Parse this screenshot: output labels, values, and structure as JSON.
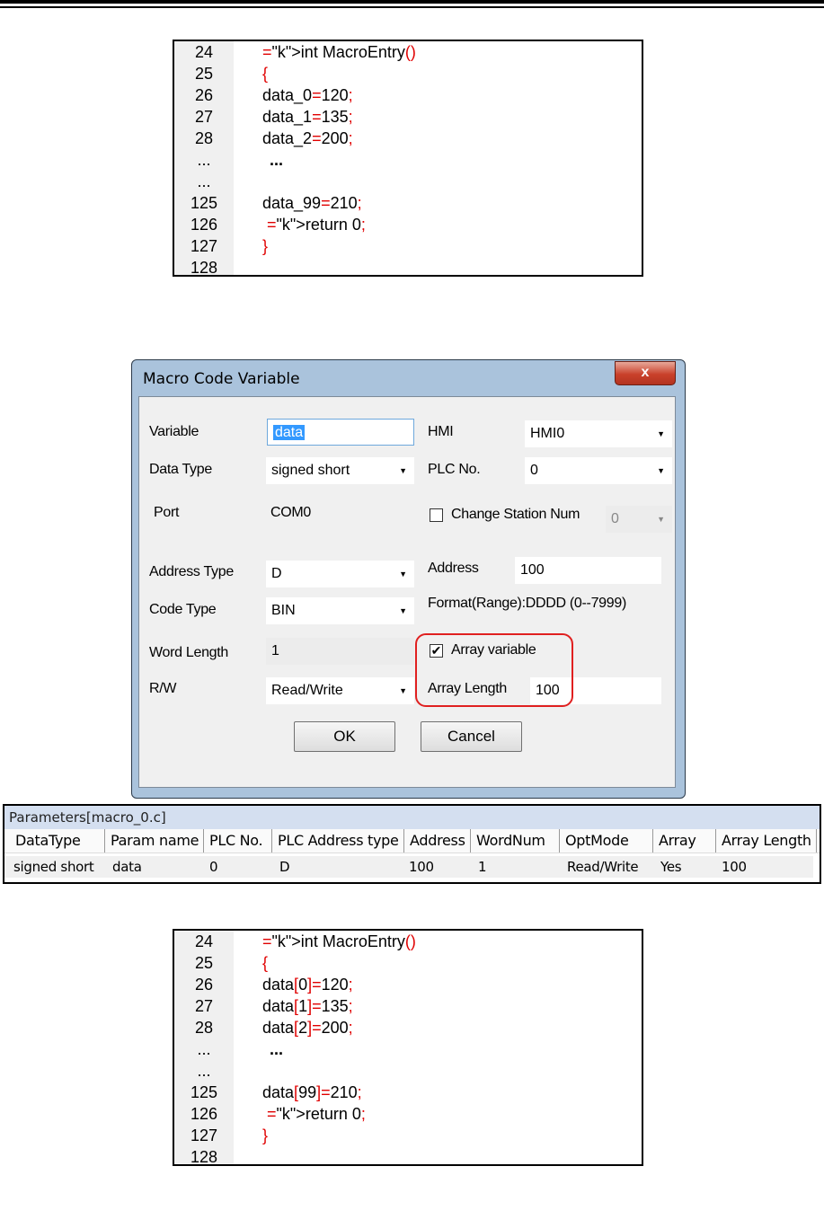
{
  "code_block_1": {
    "lines": [
      {
        "num": "24",
        "text": "int MacroEntry()"
      },
      {
        "num": "25",
        "text": "{"
      },
      {
        "num": "26",
        "text": "data_0=120;"
      },
      {
        "num": "27",
        "text": "data_1=135;"
      },
      {
        "num": "28",
        "text": "data_2=200;"
      },
      {
        "num": "...",
        "text": "..."
      },
      {
        "num": "...",
        "text": ""
      },
      {
        "num": "125",
        "text": "data_99=210;"
      },
      {
        "num": "126",
        "text": " return 0;"
      },
      {
        "num": "127",
        "text": "}"
      },
      {
        "num": "128",
        "text": ""
      }
    ]
  },
  "dialog": {
    "title": "Macro Code Variable",
    "close_glyph": "x",
    "variable_label": "Variable",
    "variable_value": "data",
    "hmi_label": "HMI",
    "hmi_value": "HMI0",
    "data_type_label": "Data Type",
    "data_type_value": "signed short",
    "plc_no_label": "PLC No.",
    "plc_no_value": "0",
    "port_label": "Port",
    "port_value": "COM0",
    "change_station_label": "Change Station Num",
    "change_station_value": "0",
    "address_type_label": "Address Type",
    "address_type_value": "D",
    "address_label": "Address",
    "address_value": "100",
    "code_type_label": "Code Type",
    "code_type_value": "BIN",
    "format_text": "Format(Range):DDDD (0--7999)",
    "word_length_label": "Word Length",
    "word_length_value": "1",
    "array_variable_label": "Array variable",
    "array_variable_checked": true,
    "rw_label": "R/W",
    "rw_value": "Read/Write",
    "array_length_label": "Array Length",
    "array_length_value": "100",
    "ok_label": "OK",
    "cancel_label": "Cancel"
  },
  "parameters": {
    "title": "Parameters[macro_0.c]",
    "headers": [
      "DataType",
      "Param name",
      "PLC No.",
      "PLC Address type",
      "Address",
      "WordNum",
      "OptMode",
      "Array",
      "Array Length"
    ],
    "row": [
      "signed short",
      "data",
      "0",
      "D",
      "100",
      "1",
      "Read/Write",
      "Yes",
      "100"
    ]
  },
  "code_block_2": {
    "lines": [
      {
        "num": "24",
        "text": "int MacroEntry()"
      },
      {
        "num": "25",
        "text": "{"
      },
      {
        "num": "26",
        "text": "data[0]=120;"
      },
      {
        "num": "27",
        "text": "data[1]=135;"
      },
      {
        "num": "28",
        "text": "data[2]=200;"
      },
      {
        "num": "...",
        "text": "..."
      },
      {
        "num": "...",
        "text": ""
      },
      {
        "num": "125",
        "text": "data[99]=210;"
      },
      {
        "num": "126",
        "text": " return 0;"
      },
      {
        "num": "127",
        "text": "}"
      },
      {
        "num": "128",
        "text": ""
      }
    ]
  }
}
